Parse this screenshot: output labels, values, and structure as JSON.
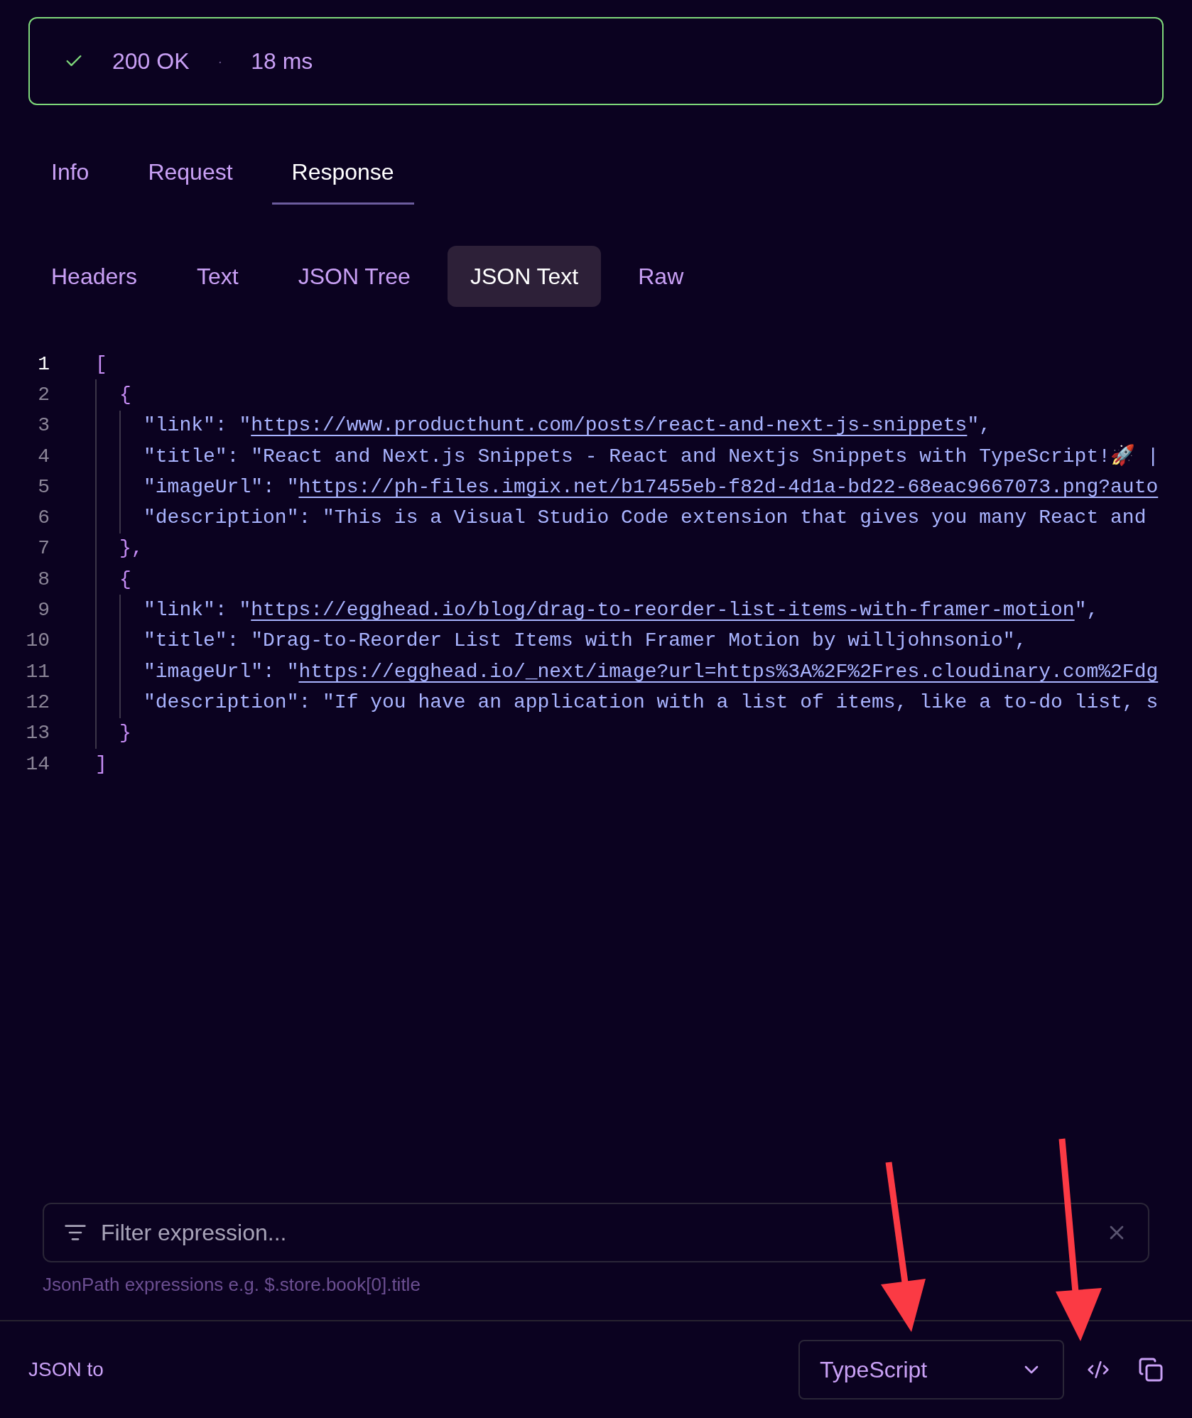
{
  "status": {
    "ok": true,
    "code": "200 OK",
    "separator": "·",
    "time": "18 ms"
  },
  "tabs": [
    {
      "label": "Info",
      "selected": false
    },
    {
      "label": "Request",
      "selected": false
    },
    {
      "label": "Response",
      "selected": true
    }
  ],
  "view_tabs": [
    {
      "label": "Headers",
      "selected": false
    },
    {
      "label": "Text",
      "selected": false
    },
    {
      "label": "JSON Tree",
      "selected": false
    },
    {
      "label": "JSON Text",
      "selected": true
    },
    {
      "label": "Raw",
      "selected": false
    }
  ],
  "code": {
    "lines": [
      {
        "number": "1",
        "current": true,
        "segments": [
          {
            "kind": "bracket",
            "text": "["
          }
        ],
        "children": [
          {
            "number": "2",
            "current": false,
            "segments": [
              {
                "kind": "bracket",
                "text": "{"
              }
            ],
            "children": [
              {
                "number": "3",
                "current": false,
                "segments": [
                  {
                    "kind": "plain",
                    "text": "\"link\": \""
                  },
                  {
                    "kind": "link",
                    "text": "https://www.producthunt.com/posts/react-and-next-js-snippets"
                  },
                  {
                    "kind": "plain",
                    "text": "\","
                  }
                ]
              },
              {
                "number": "4",
                "current": false,
                "segments": [
                  {
                    "kind": "plain",
                    "text": "\"title\": \"React and Next.js Snippets - React and Nextjs Snippets with TypeScript!🚀 |"
                  }
                ]
              },
              {
                "number": "5",
                "current": false,
                "segments": [
                  {
                    "kind": "plain",
                    "text": "\"imageUrl\": \""
                  },
                  {
                    "kind": "link",
                    "text": "https://ph-files.imgix.net/b17455eb-f82d-4d1a-bd22-68eac9667073.png?auto"
                  }
                ]
              },
              {
                "number": "6",
                "current": false,
                "segments": [
                  {
                    "kind": "plain",
                    "text": "\"description\": \"This is a Visual Studio Code extension that gives you many React and"
                  }
                ]
              }
            ]
          },
          {
            "number": "7",
            "current": false,
            "segments": [
              {
                "kind": "bracket",
                "text": "},"
              }
            ]
          },
          {
            "number": "8",
            "current": false,
            "segments": [
              {
                "kind": "bracket",
                "text": "{"
              }
            ],
            "children": [
              {
                "number": "9",
                "current": false,
                "segments": [
                  {
                    "kind": "plain",
                    "text": "\"link\": \""
                  },
                  {
                    "kind": "link",
                    "text": "https://egghead.io/blog/drag-to-reorder-list-items-with-framer-motion"
                  },
                  {
                    "kind": "plain",
                    "text": "\","
                  }
                ]
              },
              {
                "number": "10",
                "current": false,
                "segments": [
                  {
                    "kind": "plain",
                    "text": "\"title\": \"Drag-to-Reorder List Items with Framer Motion by willjohnsonio\","
                  }
                ]
              },
              {
                "number": "11",
                "current": false,
                "segments": [
                  {
                    "kind": "plain",
                    "text": "\"imageUrl\": \""
                  },
                  {
                    "kind": "link",
                    "text": "https://egghead.io/_next/image?url=https%3A%2F%2Fres.cloudinary.com%2Fdg"
                  }
                ]
              },
              {
                "number": "12",
                "current": false,
                "segments": [
                  {
                    "kind": "plain",
                    "text": "\"description\": \"If you have an application with a list of items, like a to-do list, s"
                  }
                ]
              }
            ]
          },
          {
            "number": "13",
            "current": false,
            "segments": [
              {
                "kind": "bracket",
                "text": "}"
              }
            ]
          }
        ]
      },
      {
        "number": "14",
        "current": false,
        "segments": [
          {
            "kind": "bracket",
            "text": "]"
          }
        ]
      }
    ]
  },
  "filter": {
    "placeholder": "Filter expression...",
    "hint": "JsonPath expressions e.g. $.store.book[0].title"
  },
  "footer": {
    "label": "JSON to",
    "language": "TypeScript"
  }
}
